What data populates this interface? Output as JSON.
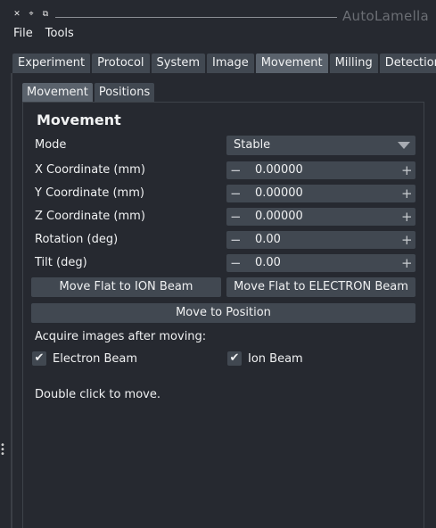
{
  "window": {
    "title": "AutoLamella",
    "controls": [
      "close-icon",
      "float-icon",
      "restore-icon"
    ]
  },
  "menubar": {
    "items": [
      "File",
      "Tools"
    ]
  },
  "main_tabs": {
    "items": [
      "Experiment",
      "Protocol",
      "System",
      "Image",
      "Movement",
      "Milling",
      "Detection"
    ],
    "active": "Movement"
  },
  "inner_tabs": {
    "items": [
      "Movement",
      "Positions"
    ],
    "active": "Movement"
  },
  "movement": {
    "title": "Movement",
    "mode": {
      "label": "Mode",
      "value": "Stable"
    },
    "x": {
      "label": "X Coordinate (mm)",
      "value": "0.00000"
    },
    "y": {
      "label": "Y Coordinate (mm)",
      "value": "0.00000"
    },
    "z": {
      "label": "Z Coordinate (mm)",
      "value": "0.00000"
    },
    "rotation": {
      "label": "Rotation (deg)",
      "value": "0.00"
    },
    "tilt": {
      "label": "Tilt (deg)",
      "value": "0.00"
    },
    "minus_glyph": "−",
    "plus_glyph": "+",
    "buttons": {
      "flat_ion": "Move Flat to ION Beam",
      "flat_electron": "Move Flat to ELECTRON Beam",
      "move_to_position": "Move to Position"
    },
    "acquire_label": "Acquire images after moving:",
    "electron_beam": {
      "label": "Electron Beam",
      "checked": true
    },
    "ion_beam": {
      "label": "Ion Beam",
      "checked": true
    },
    "hint": "Double click to move."
  }
}
